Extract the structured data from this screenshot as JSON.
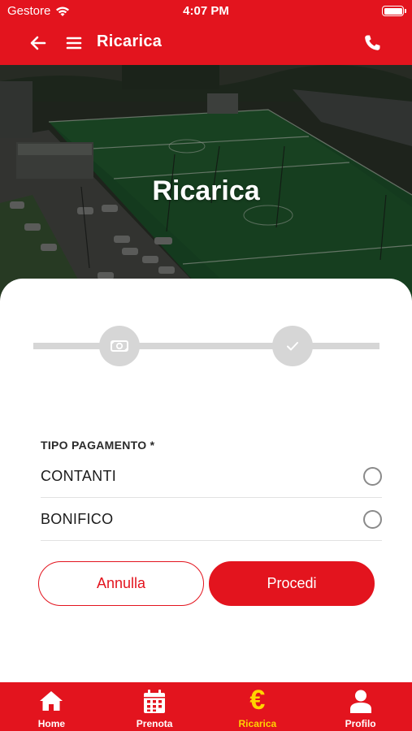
{
  "status_bar": {
    "carrier": "Gestore",
    "time": "4:07 PM"
  },
  "header": {
    "title": "Ricarica"
  },
  "hero": {
    "title": "Ricarica"
  },
  "form": {
    "payment_label": "TIPO PAGAMENTO *",
    "options": [
      {
        "label": "CONTANTI",
        "selected": false
      },
      {
        "label": "BONIFICO",
        "selected": false
      }
    ],
    "cancel_label": "Annulla",
    "proceed_label": "Procedi"
  },
  "stepper": {
    "steps": [
      "cash-icon",
      "check-icon"
    ],
    "current": 0
  },
  "tabbar": {
    "items": [
      {
        "label": "Home",
        "icon": "home-icon"
      },
      {
        "label": "Prenota",
        "icon": "calendar-icon"
      },
      {
        "label": "Ricarica",
        "icon": "euro-icon",
        "active": true,
        "glyph": "€"
      },
      {
        "label": "Profilo",
        "icon": "user-icon"
      }
    ]
  },
  "colors": {
    "brand": "#e3141e",
    "active_tab": "#ffd400",
    "step_inactive": "#d6d6d6"
  }
}
